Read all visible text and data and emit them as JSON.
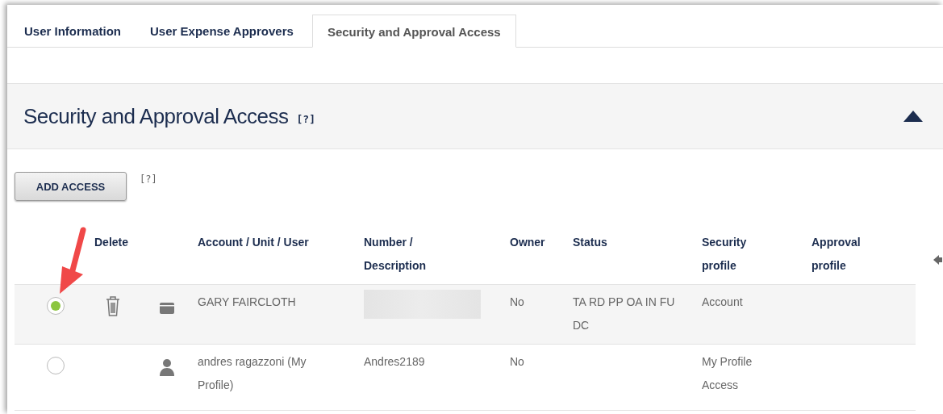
{
  "tabs": [
    {
      "label": "User Information",
      "selected": false
    },
    {
      "label": "User Expense Approvers",
      "selected": false
    },
    {
      "label": "Security and Approval Access",
      "selected": true
    }
  ],
  "section": {
    "title": "Security and Approval Access",
    "help": "[?]",
    "expanded": true
  },
  "add_button": {
    "label": "ADD ACCESS",
    "help": "[?]"
  },
  "table": {
    "columns": [
      "",
      "Delete",
      "",
      "Account / Unit / User",
      "Number / Description",
      "Owner",
      "Status",
      "Security profile",
      "Approval profile"
    ],
    "rows": [
      {
        "selected": true,
        "deletable": true,
        "kind": "account",
        "name": "GARY FAIRCLOTH",
        "number_redacted": true,
        "number": "",
        "owner": "No",
        "status": "TA RD PP OA IN FU DC",
        "security_profile": "Account",
        "approval_profile": ""
      },
      {
        "selected": false,
        "deletable": false,
        "kind": "user",
        "name": "andres ragazzoni (My Profile)",
        "number_redacted": false,
        "number": "Andres2189",
        "owner": "No",
        "status": "",
        "security_profile": "My Profile Access",
        "approval_profile": ""
      }
    ]
  }
}
